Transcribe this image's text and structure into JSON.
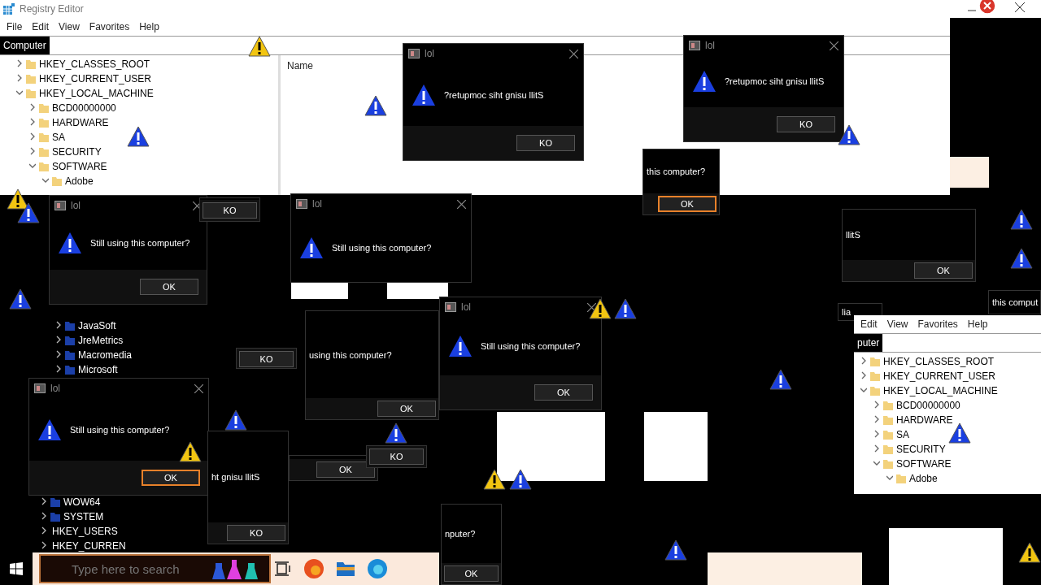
{
  "registry_editor": {
    "title": "Registry Editor",
    "menu": [
      "File",
      "Edit",
      "View",
      "Favorites",
      "Help"
    ],
    "address": "Computer",
    "column": "Name",
    "tree": [
      {
        "label": "HKEY_CLASSES_ROOT",
        "expanded": false
      },
      {
        "label": "HKEY_CURRENT_USER",
        "expanded": false
      },
      {
        "label": "HKEY_LOCAL_MACHINE",
        "expanded": true,
        "children": [
          {
            "label": "BCD00000000",
            "expanded": false
          },
          {
            "label": "HARDWARE",
            "expanded": false
          },
          {
            "label": "SA",
            "expanded": false
          },
          {
            "label": "SECURITY",
            "expanded": false
          },
          {
            "label": "SOFTWARE",
            "expanded": true,
            "children": [
              {
                "label": "Adobe",
                "expanded": true
              }
            ]
          }
        ]
      }
    ]
  },
  "tree_fragments": [
    {
      "items": [
        {
          "label": "JavaSoft",
          "expanded": false
        },
        {
          "label": "JreMetrics",
          "expanded": false
        },
        {
          "label": "Macromedia",
          "expanded": false
        },
        {
          "label": "Microsoft",
          "expanded": false
        }
      ]
    },
    {
      "items": [
        {
          "label": "WOW64",
          "expanded": false
        },
        {
          "label": "SYSTEM",
          "expanded": false
        },
        {
          "label": "HKEY_USERS",
          "expanded": false
        },
        {
          "label": "HKEY_CURREN",
          "expanded": false
        }
      ]
    }
  ],
  "registry_copy": {
    "menu": [
      "Edit",
      "View",
      "Favorites",
      "Help"
    ],
    "address": "puter",
    "tree": [
      {
        "label": "HKEY_CLASSES_ROOT",
        "expanded": false
      },
      {
        "label": "HKEY_CURRENT_USER",
        "expanded": false
      },
      {
        "label": "HKEY_LOCAL_MACHINE",
        "expanded": true,
        "children": [
          {
            "label": "BCD00000000",
            "expanded": false
          },
          {
            "label": "HARDWARE",
            "expanded": false
          },
          {
            "label": "SA",
            "expanded": false
          },
          {
            "label": "SECURITY",
            "expanded": false
          },
          {
            "label": "SOFTWARE",
            "expanded": true,
            "children": [
              {
                "label": "Adobe",
                "expanded": true
              }
            ]
          }
        ]
      }
    ]
  },
  "dialogs": [
    {
      "title": "lol",
      "message": "?retupmoc siht gnisu llitS",
      "button": "KO",
      "focused": false
    },
    {
      "title": "lol",
      "message": "?retupmoc siht gnisu llitS",
      "button": "KO",
      "focused": false
    },
    {
      "title": "lol",
      "message": "Still using this computer?",
      "button": "OK",
      "focused": false
    },
    {
      "title": "lol",
      "message": "Still using this computer?"
    },
    {
      "title": "lol",
      "message": "Still using this computer?",
      "button": "OK",
      "focused": false
    },
    {
      "message": "using this computer?",
      "button": "OK",
      "focused": false
    },
    {
      "title": "lol",
      "message": "Still using this computer?",
      "button": "OK",
      "focused": true
    },
    {
      "message": "ht gnisu llitS",
      "button": "KO",
      "focused": false
    },
    {
      "message": "this computer?",
      "button": "OK",
      "focused": true
    },
    {
      "message": "llitS",
      "button": "OK",
      "focused": false
    },
    {
      "button": "OK",
      "focused": false
    },
    {
      "message": "nputer?",
      "button": "OK",
      "focused": false
    },
    {
      "message": "this comput"
    },
    {
      "button": "KO",
      "focused": false
    },
    {
      "button": "KO",
      "focused": false
    },
    {
      "button": "KO",
      "focused": false
    },
    {
      "message": "lia"
    }
  ],
  "taskbar": {
    "placeholder": "Type here to search"
  }
}
